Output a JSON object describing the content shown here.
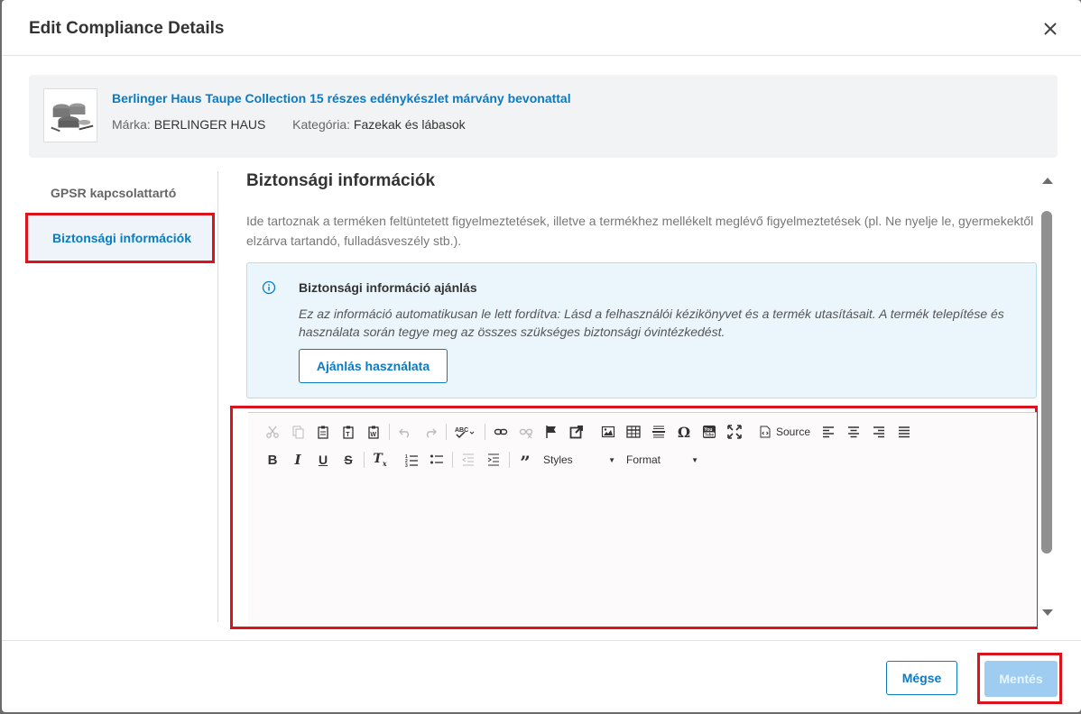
{
  "dialog": {
    "title": "Edit Compliance Details",
    "close_icon": "close-icon"
  },
  "product": {
    "title": "Berlinger Haus Taupe Collection 15 részes edénykészlet márvány bevonattal",
    "brand_label": "Márka:",
    "brand_value": "BERLINGER HAUS",
    "category_label": "Kategória:",
    "category_value": "Fazekak és lábasok"
  },
  "sidebar": {
    "items": [
      {
        "label": "GPSR kapcsolattartó",
        "active": false
      },
      {
        "label": "Biztonsági információk",
        "active": true
      }
    ]
  },
  "section": {
    "title": "Biztonsági információk",
    "description": "Ide tartoznak a terméken feltüntetett figyelmeztetések, illetve a termékhez mellékelt meglévő figyelmeztetések (pl. Ne nyelje le, gyermekektől elzárva tartandó, fulladásveszély stb.)."
  },
  "recommendation": {
    "title": "Biztonsági információ ajánlás",
    "text": "Ez az információ automatikusan le lett fordítva: Lásd a felhasználói kézikönyvet és a termék utasításait. A termék telepítése és használata során tegye meg az összes szükséges biztonsági óvintézkedést.",
    "button_label": "Ajánlás használata"
  },
  "editor": {
    "source_label": "Source",
    "styles_label": "Styles",
    "format_label": "Format",
    "content": ""
  },
  "footer": {
    "cancel_label": "Mégse",
    "save_label": "Mentés"
  },
  "colors": {
    "accent": "#0a7bc2",
    "highlight_border": "#d9141c",
    "info_bg": "#eaf6fc",
    "save_disabled": "#9ecdf1"
  }
}
